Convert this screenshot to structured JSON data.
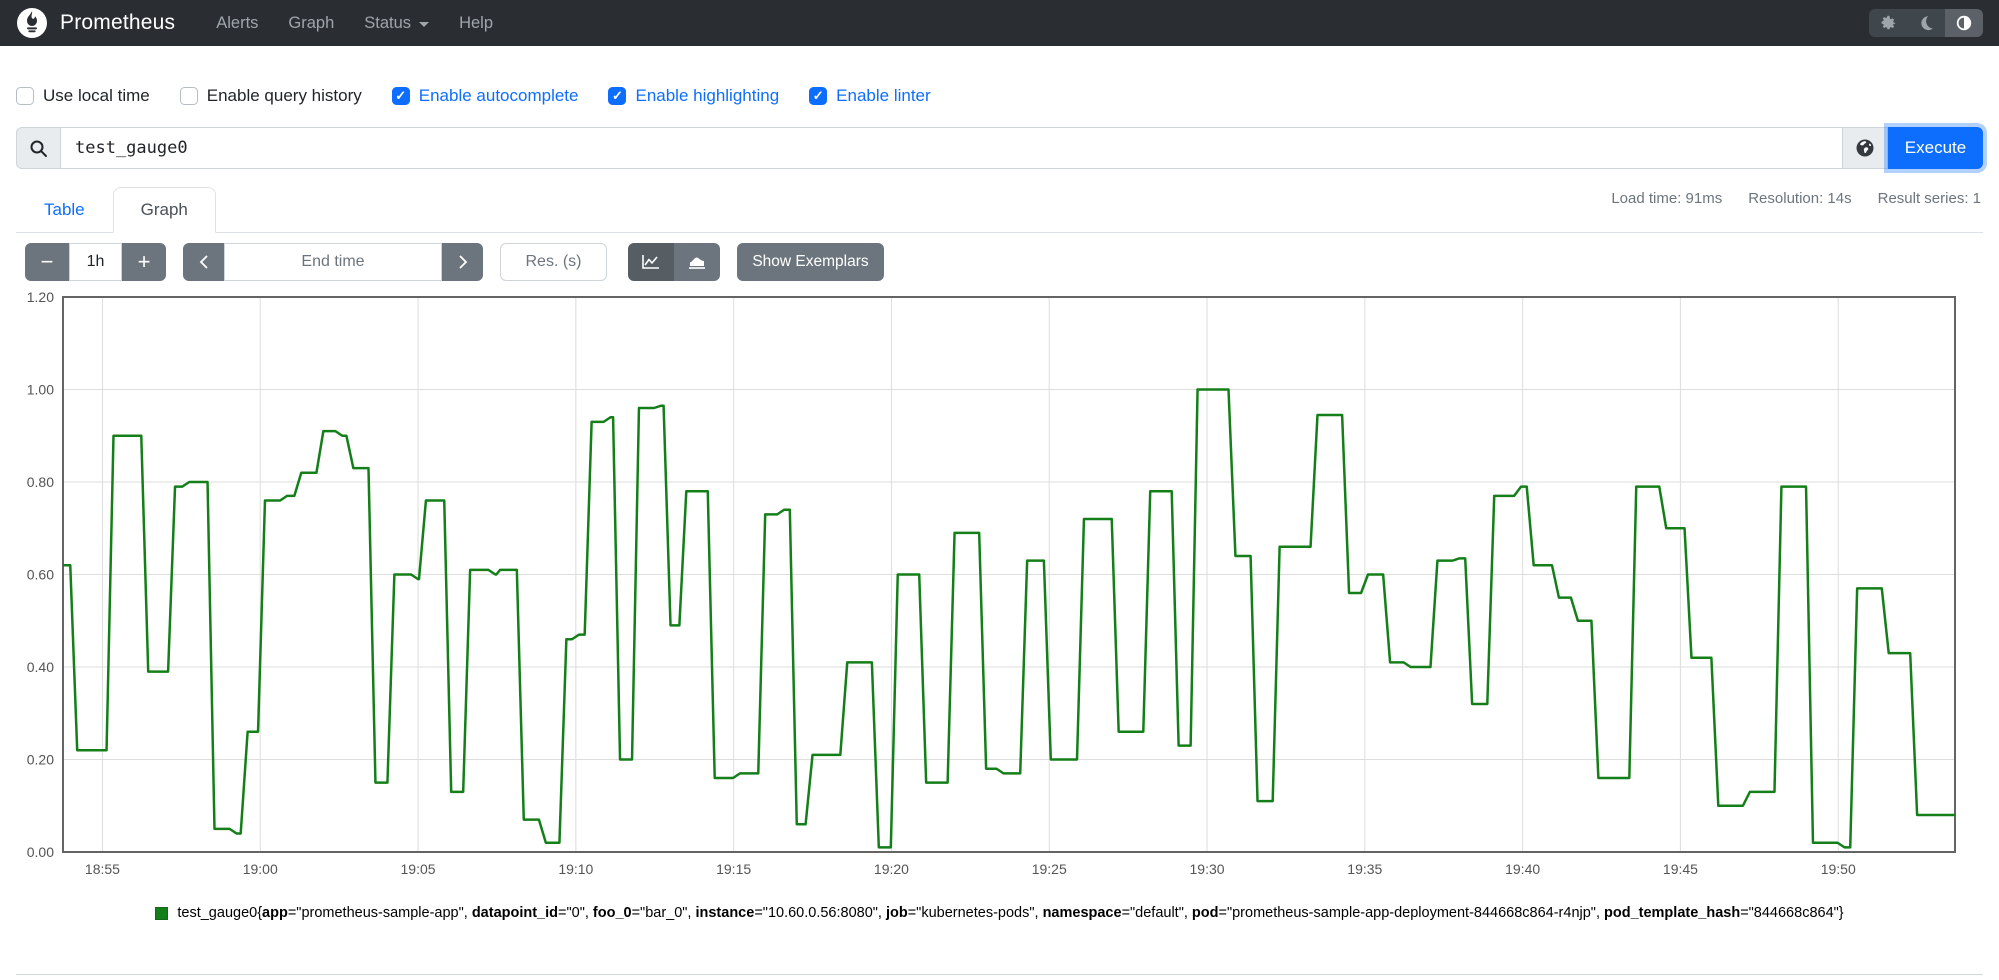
{
  "navbar": {
    "brand": "Prometheus",
    "items": [
      {
        "label": "Alerts"
      },
      {
        "label": "Graph"
      },
      {
        "label": "Status",
        "has_caret": true
      },
      {
        "label": "Help"
      }
    ],
    "theme_toggle": {
      "active": "contrast-icon"
    }
  },
  "options": [
    {
      "label": "Use local time",
      "checked": false
    },
    {
      "label": "Enable query history",
      "checked": false
    },
    {
      "label": "Enable autocomplete",
      "checked": true
    },
    {
      "label": "Enable highlighting",
      "checked": true
    },
    {
      "label": "Enable linter",
      "checked": true
    }
  ],
  "query": {
    "value": "test_gauge0",
    "execute_label": "Execute"
  },
  "tabs": [
    {
      "label": "Table",
      "active": false
    },
    {
      "label": "Graph",
      "active": true
    }
  ],
  "stats": {
    "load_time": "Load time: 91ms",
    "resolution": "Resolution: 14s",
    "result_series": "Result series: 1"
  },
  "graph_controls": {
    "range_decrease": "−",
    "range": "1h",
    "range_increase": "+",
    "end_time_placeholder": "End time",
    "resolution_placeholder": "Res. (s)",
    "show_exemplars": "Show Exemplars",
    "chart_mode_active": "line"
  },
  "chart_data": {
    "type": "line",
    "line_style": "step",
    "color": "#147f19",
    "grid": true,
    "x_range": [
      1133.75,
      1193.7
    ],
    "y_range": [
      0,
      1.2
    ],
    "x_ticks": [
      {
        "t": 1135,
        "label": "18:55"
      },
      {
        "t": 1140,
        "label": "19:00"
      },
      {
        "t": 1145,
        "label": "19:05"
      },
      {
        "t": 1150,
        "label": "19:10"
      },
      {
        "t": 1155,
        "label": "19:15"
      },
      {
        "t": 1160,
        "label": "19:20"
      },
      {
        "t": 1165,
        "label": "19:25"
      },
      {
        "t": 1170,
        "label": "19:30"
      },
      {
        "t": 1175,
        "label": "19:35"
      },
      {
        "t": 1180,
        "label": "19:40"
      },
      {
        "t": 1185,
        "label": "19:45"
      },
      {
        "t": 1190,
        "label": "19:50"
      }
    ],
    "y_ticks": [
      {
        "v": 0.0,
        "label": "0.00"
      },
      {
        "v": 0.2,
        "label": "0.20"
      },
      {
        "v": 0.4,
        "label": "0.40"
      },
      {
        "v": 0.6,
        "label": "0.60"
      },
      {
        "v": 0.8,
        "label": "0.80"
      },
      {
        "v": 1.0,
        "label": "1.00"
      },
      {
        "v": 1.2,
        "label": "1.20"
      }
    ],
    "series": [
      {
        "name": "test_gauge0",
        "labels": [
          [
            "app",
            "prometheus-sample-app"
          ],
          [
            "datapoint_id",
            "0"
          ],
          [
            "foo_0",
            "bar_0"
          ],
          [
            "instance",
            "10.60.0.56:8080"
          ],
          [
            "job",
            "kubernetes-pods"
          ],
          [
            "namespace",
            "default"
          ],
          [
            "pod",
            "prometheus-sample-app-deployment-844668c864-r4njp"
          ],
          [
            "pod_template_hash",
            "844668c864"
          ]
        ],
        "steps": [
          [
            1133.75,
            0.62
          ],
          [
            1134.2,
            0.22
          ],
          [
            1135.35,
            0.9
          ],
          [
            1136.45,
            0.39
          ],
          [
            1137.3,
            0.79
          ],
          [
            1137.75,
            0.8
          ],
          [
            1138.55,
            0.05
          ],
          [
            1139.25,
            0.04
          ],
          [
            1139.6,
            0.26
          ],
          [
            1140.15,
            0.76
          ],
          [
            1140.85,
            0.77
          ],
          [
            1141.3,
            0.82
          ],
          [
            1142.0,
            0.91
          ],
          [
            1142.6,
            0.9
          ],
          [
            1142.95,
            0.83
          ],
          [
            1143.65,
            0.15
          ],
          [
            1144.25,
            0.6
          ],
          [
            1145.0,
            0.59
          ],
          [
            1145.25,
            0.76
          ],
          [
            1146.05,
            0.13
          ],
          [
            1146.65,
            0.61
          ],
          [
            1147.45,
            0.6
          ],
          [
            1147.6,
            0.61
          ],
          [
            1148.35,
            0.07
          ],
          [
            1149.05,
            0.02
          ],
          [
            1149.7,
            0.46
          ],
          [
            1150.1,
            0.47
          ],
          [
            1150.5,
            0.93
          ],
          [
            1151.1,
            0.94
          ],
          [
            1151.4,
            0.2
          ],
          [
            1152.0,
            0.96
          ],
          [
            1152.7,
            0.965
          ],
          [
            1153.0,
            0.49
          ],
          [
            1153.5,
            0.78
          ],
          [
            1154.4,
            0.16
          ],
          [
            1155.2,
            0.17
          ],
          [
            1156.0,
            0.73
          ],
          [
            1156.6,
            0.74
          ],
          [
            1157.0,
            0.06
          ],
          [
            1157.5,
            0.21
          ],
          [
            1158.6,
            0.41
          ],
          [
            1159.6,
            0.01
          ],
          [
            1160.2,
            0.6
          ],
          [
            1161.1,
            0.15
          ],
          [
            1162.0,
            0.69
          ],
          [
            1163.0,
            0.18
          ],
          [
            1163.55,
            0.17
          ],
          [
            1164.3,
            0.63
          ],
          [
            1165.05,
            0.2
          ],
          [
            1166.1,
            0.72
          ],
          [
            1167.2,
            0.26
          ],
          [
            1168.2,
            0.78
          ],
          [
            1169.1,
            0.23
          ],
          [
            1169.7,
            1.0
          ],
          [
            1170.9,
            0.64
          ],
          [
            1171.6,
            0.11
          ],
          [
            1172.3,
            0.66
          ],
          [
            1173.5,
            0.945
          ],
          [
            1174.5,
            0.56
          ],
          [
            1175.1,
            0.6
          ],
          [
            1175.8,
            0.41
          ],
          [
            1176.45,
            0.4
          ],
          [
            1177.3,
            0.63
          ],
          [
            1178.0,
            0.635
          ],
          [
            1178.4,
            0.32
          ],
          [
            1179.1,
            0.77
          ],
          [
            1179.95,
            0.79
          ],
          [
            1180.35,
            0.62
          ],
          [
            1181.15,
            0.55
          ],
          [
            1181.75,
            0.5
          ],
          [
            1182.4,
            0.16
          ],
          [
            1183.6,
            0.79
          ],
          [
            1184.55,
            0.7
          ],
          [
            1185.35,
            0.42
          ],
          [
            1186.2,
            0.1
          ],
          [
            1187.2,
            0.13
          ],
          [
            1188.2,
            0.79
          ],
          [
            1189.2,
            0.02
          ],
          [
            1190.2,
            0.01
          ],
          [
            1190.6,
            0.57
          ],
          [
            1191.6,
            0.43
          ],
          [
            1192.5,
            0.08
          ]
        ]
      }
    ]
  }
}
